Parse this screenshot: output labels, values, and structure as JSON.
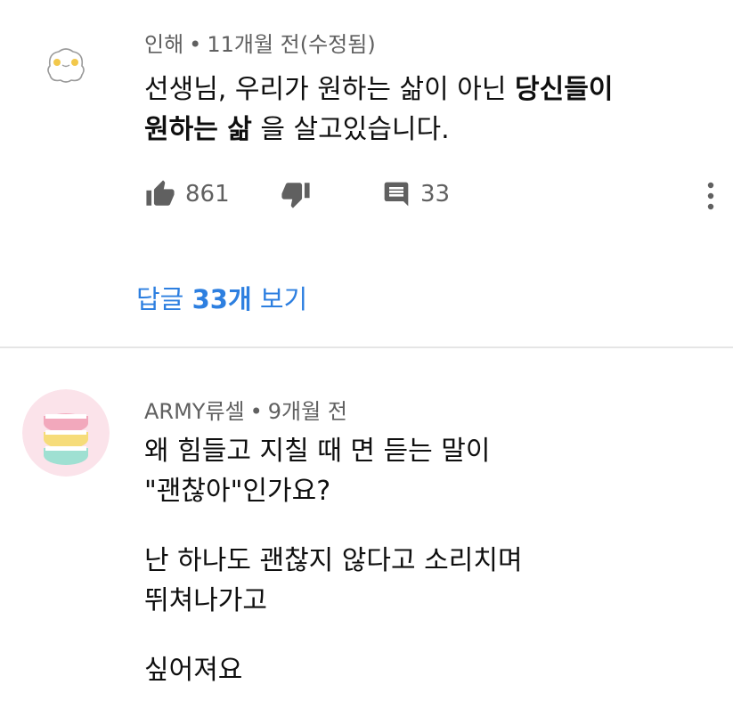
{
  "comment1": {
    "author": "인해",
    "time": "11개월 전(수정됨)",
    "separator": "•",
    "text_lines": [
      {
        "plain": "선생님, 우리가 원하는 삶이 아닌 ",
        "bold": "당신들이"
      },
      {
        "plain_after": " 을 살고있습니다.",
        "bold": "원하는 삶"
      }
    ],
    "likes": "861",
    "replies": "33",
    "view_replies": {
      "before": "답글 ",
      "count": "33개",
      "after": " 보기"
    }
  },
  "comment2": {
    "author": "ARMY류셀",
    "time": "9개월 전",
    "separator": "•",
    "text_lines": [
      "왜 힘들고 지칠 때 면 듣는 말이",
      "\"괜찮아\"인가요?",
      "",
      "난 하나도 괜찮지 않다고 소리치며",
      "뛰쳐나가고",
      "",
      "싶어져요"
    ]
  },
  "colors": {
    "link": "#2d7fe0",
    "meta": "#606060",
    "divider": "#e5e5e5"
  },
  "icons": [
    "thumbs-up-icon",
    "thumbs-down-icon",
    "comment-icon",
    "more-vert-icon"
  ]
}
